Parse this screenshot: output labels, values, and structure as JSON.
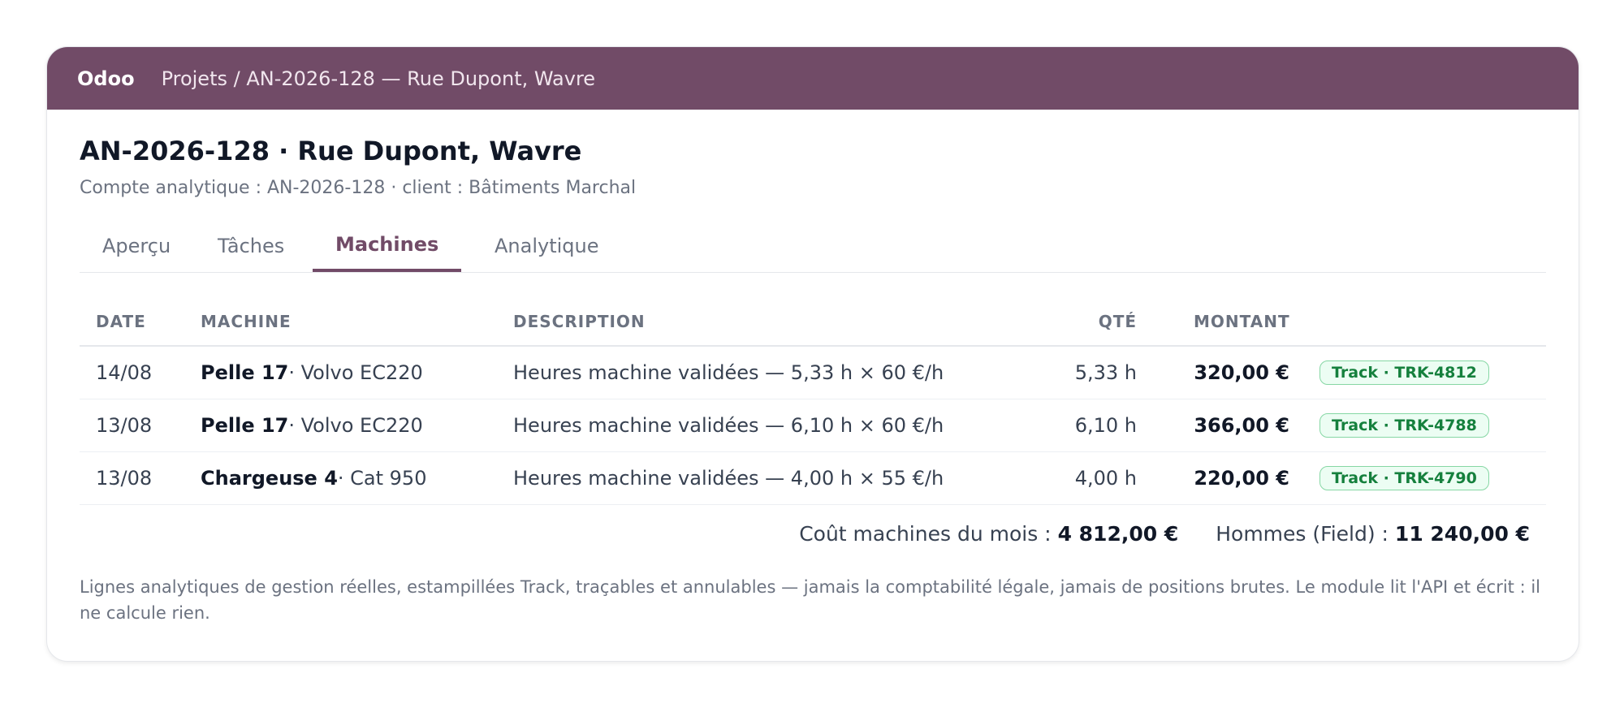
{
  "app": {
    "brand": "Odoo",
    "breadcrumb": "Projets / AN-2026-128 — Rue Dupont, Wavre"
  },
  "project": {
    "title": "AN-2026-128 · Rue Dupont, Wavre",
    "subtitle": "Compte analytique : AN-2026-128 · client : Bâtiments Marchal"
  },
  "tabs": [
    {
      "label": "Aperçu",
      "active": false
    },
    {
      "label": "Tâches",
      "active": false
    },
    {
      "label": "Machines",
      "active": true
    },
    {
      "label": "Analytique",
      "active": false
    }
  ],
  "table": {
    "headers": {
      "date": "DATE",
      "machine": "MACHINE",
      "description": "DESCRIPTION",
      "qty": "QTÉ",
      "amount": "MONTANT"
    },
    "rows": [
      {
        "date": "14/08",
        "machine": "Pelle 17",
        "model": " · Volvo EC220",
        "description": "Heures machine validées — 5,33 h × 60 €/h",
        "qty": "5,33 h",
        "amount": "320,00 €",
        "badge": "Track · TRK-4812"
      },
      {
        "date": "13/08",
        "machine": "Pelle 17",
        "model": " · Volvo EC220",
        "description": "Heures machine validées — 6,10 h × 60 €/h",
        "qty": "6,10 h",
        "amount": "366,00 €",
        "badge": "Track · TRK-4788"
      },
      {
        "date": "13/08",
        "machine": "Chargeuse 4",
        "model": " · Cat 950",
        "description": "Heures machine validées — 4,00 h × 55 €/h",
        "qty": "4,00 h",
        "amount": "220,00 €",
        "badge": "Track · TRK-4790"
      }
    ]
  },
  "totals": {
    "machines_label": "Coût machines du mois : ",
    "machines_value": "4 812,00 €",
    "men_label": "Hommes (Field) : ",
    "men_value": "11 240,00 €"
  },
  "footnote": "Lignes analytiques de gestion réelles, estampillées Track, traçables et annulables — jamais la comptabilité légale, jamais de positions brutes. Le module lit l'API et écrit : il ne calcule rien.",
  "colors": {
    "brand": "#714b67",
    "badge_bg": "#ecfdf3",
    "badge_text": "#15803d"
  }
}
